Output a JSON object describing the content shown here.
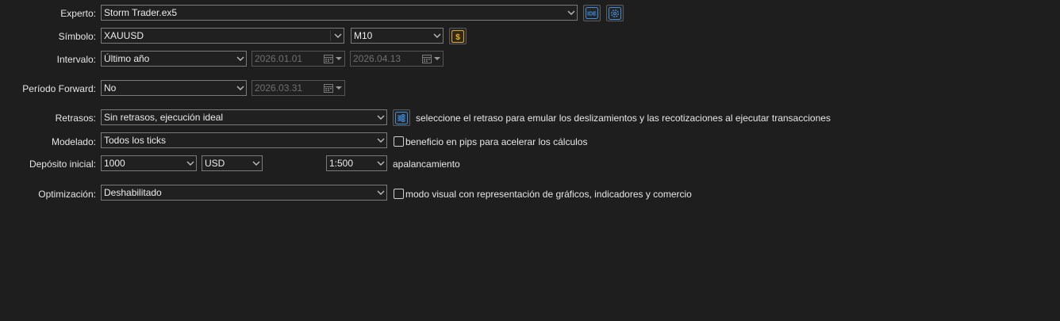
{
  "rows": {
    "expert": {
      "label": "Experto:",
      "value": "Storm Trader.ex5"
    },
    "symbol": {
      "label": "Símbolo:",
      "value": "XAUUSD",
      "timeframe": "M10"
    },
    "interval": {
      "label": "Intervalo:",
      "value": "Último año",
      "date_from": "2026.01.01",
      "date_to": "2026.04.13"
    },
    "forward": {
      "label": "Período Forward:",
      "value": "No",
      "date": "2026.03.31"
    },
    "delays": {
      "label": "Retrasos:",
      "value": "Sin retrasos, ejecución ideal",
      "hint": "seleccione el retraso para emular los deslizamientos y las recotizaciones al ejecutar transacciones"
    },
    "modeling": {
      "label": "Modelado:",
      "value": "Todos los ticks",
      "checkbox_label": "beneficio en pips para acelerar los cálculos",
      "checked": false
    },
    "deposit": {
      "label": "Depósito inicial:",
      "value": "1000",
      "currency": "USD",
      "leverage": "1:500",
      "leverage_label": "apalancamiento"
    },
    "optimization": {
      "label": "Optimización:",
      "value": "Deshabilitado",
      "checkbox_label": "modo visual con representación de gráficos, indicadores y comercio",
      "checked": false
    }
  },
  "icons": {
    "ide": "IDE",
    "dollar": "$"
  },
  "colors": {
    "background": "#1e1e1e",
    "accent_blue": "#3d8fe0",
    "accent_gold": "#d6a12c"
  }
}
